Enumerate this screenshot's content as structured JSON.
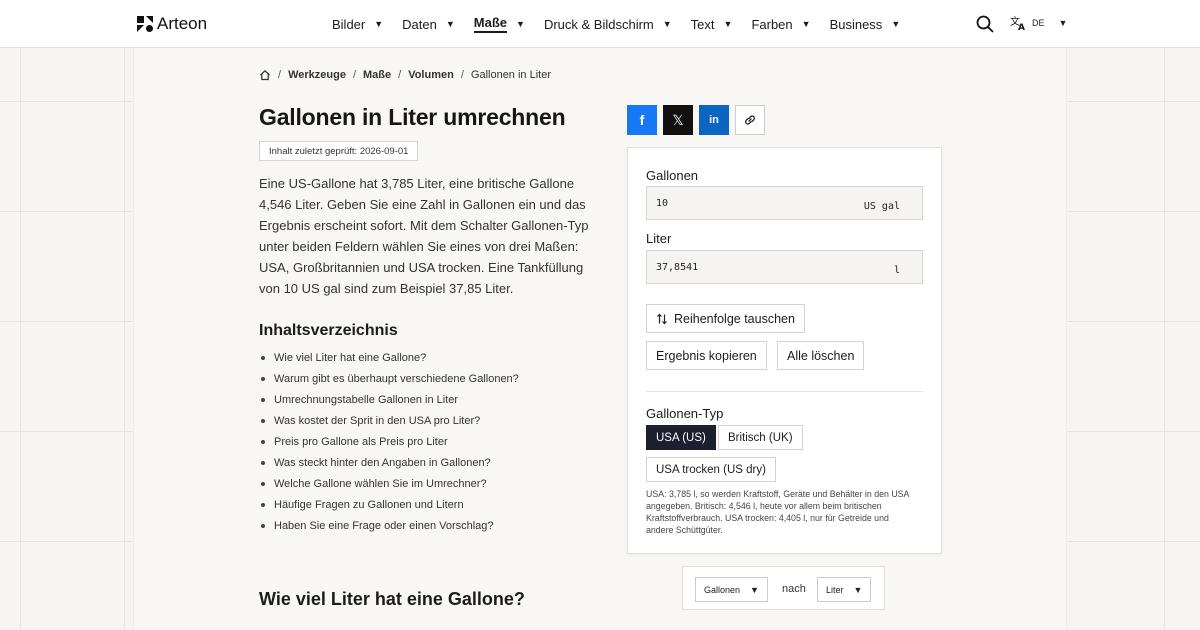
{
  "brand": {
    "name": "Arteon"
  },
  "nav": {
    "items": [
      {
        "label": "Bilder",
        "active": false
      },
      {
        "label": "Daten",
        "active": false
      },
      {
        "label": "Maße",
        "active": true
      },
      {
        "label": "Druck & Bildschirm",
        "active": false
      },
      {
        "label": "Text",
        "active": false
      },
      {
        "label": "Farben",
        "active": false
      },
      {
        "label": "Business",
        "active": false
      }
    ],
    "search_icon": "search-icon",
    "language": {
      "icon": "translate-icon",
      "code": "DE"
    }
  },
  "breadcrumb": {
    "home_icon": "home-icon",
    "items": [
      "Werkzeuge",
      "Maße",
      "Volumen",
      "Gallonen in Liter"
    ]
  },
  "article": {
    "title": "Gallonen in Liter umrechnen",
    "reviewed": "Inhalt zuletzt geprüft: 2026-09-01",
    "intro": "Eine US-Gallone hat 3,785 Liter, eine britische Gallone 4,546 Liter. Geben Sie eine Zahl in Gallonen ein und das Ergebnis erscheint sofort. Mit dem Schalter Gallonen-Typ unter beiden Feldern wählen Sie eines von drei Maßen: USA, Großbritannien und USA trocken. Eine Tankfüllung von 10 US gal sind zum Beispiel 37,85 Liter.",
    "toc_title": "Inhaltsverzeichnis",
    "toc": [
      "Wie viel Liter hat eine Gallone?",
      "Warum gibt es überhaupt verschiedene Gallonen?",
      "Umrechnungstabelle Gallonen in Liter",
      "Was kostet der Sprit in den USA pro Liter?",
      "Preis pro Gallone als Preis pro Liter",
      "Was steckt hinter den Angaben in Gallonen?",
      "Welche Gallone wählen Sie im Umrechner?",
      "Häufige Fragen zu Gallonen und Litern",
      "Haben Sie eine Frage oder einen Vorschlag?"
    ],
    "section_heading": "Wie viel Liter hat eine Gallone?"
  },
  "share": {
    "facebook": "f",
    "x": "𝕏",
    "linkedin": "in",
    "link_icon": "link-icon"
  },
  "converter": {
    "from_label": "Gallonen",
    "from_value": "10",
    "from_unit": "US gal",
    "to_label": "Liter",
    "to_value": "37,8541",
    "to_unit": "l",
    "swap_icon": "swap-icon",
    "swap_label": "Reihenfolge tauschen",
    "copy_label": "Ergebnis kopieren",
    "clear_label": "Alle löschen",
    "type_label": "Gallonen-Typ",
    "types": [
      {
        "label": "USA (US)",
        "selected": true
      },
      {
        "label": "Britisch (UK)",
        "selected": false
      },
      {
        "label": "USA trocken (US dry)",
        "selected": false
      }
    ],
    "note": "USA: 3,785 l, so werden Kraftstoff, Geräte und Behälter in den USA angegeben. Britisch: 4,546 l, heute vor allem beim britischen Kraftstoffverbrauch. USA trocken: 4,405 l, nur für Getreide und andere Schüttgüter."
  },
  "unit_pair": {
    "from": "Gallonen",
    "connector": "nach",
    "to": "Liter"
  }
}
